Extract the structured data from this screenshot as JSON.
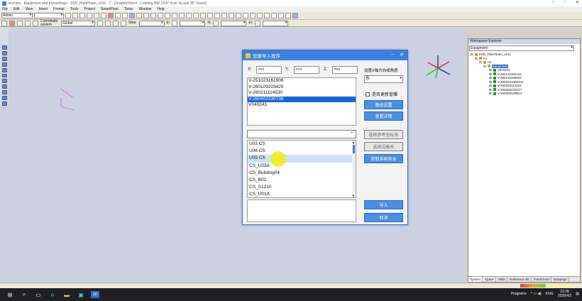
{
  "window": {
    "title": "test.ses - Equipment and Furnishings - SSD_PlantTeam_v131 - T - [GraphicView1 - Looking NW (315° from N) and 35° Down]"
  },
  "menu": [
    "File",
    "Edit",
    "View",
    "Insert",
    "Format",
    "Tools",
    "Project",
    "SmartPlant",
    "Tasks",
    "Window",
    "Help"
  ],
  "toolbar": {
    "filter": "Admin",
    "coord_label": "Coordinate system",
    "coord_value": "Global",
    "step_label": "Step:"
  },
  "dialog": {
    "title": "设备导入程序",
    "x_label": "X:",
    "y_label": "Y:",
    "z_label": "Z:",
    "x_placeholder": "mm",
    "y_placeholder": "mm",
    "z_placeholder": "mm",
    "angle_label": "设置X轴方向或角度",
    "angle_value": "东",
    "vessels": [
      "V-251023161906",
      "V-260109223425",
      "V-260211114530",
      "V-260402230736",
      "V040241"
    ],
    "selected_vessel": "V-260402230736",
    "checkbox_label": "是否更新管嘴",
    "path_button": "路径设置",
    "detail_button": "查看详情",
    "ref_coord_button": "选择参考坐标系",
    "select_equip_button": "选择设备系",
    "get_dir_button": "获取系统目录",
    "cs_items": [
      "U03 CS",
      "U06 CS",
      "U05 CS",
      "CS_U03A",
      "CS_Building04",
      "CS_B02",
      "CS_S1210",
      "CS_U01A"
    ],
    "highlighted_cs": "U05 CS",
    "import_button": "导入",
    "cancel_button": "取消"
  },
  "explorer": {
    "title": "Workspace Explorer",
    "filter": "Equipment",
    "root": "SSD_PlantTeam_v131",
    "a1": "A1",
    "u1": "U1",
    "equipment_node": "Equipment",
    "items": [
      "V040241",
      "V-260112184144",
      "V-260115185003",
      "V-2603241000341",
      "V-260326114224",
      "V-260326120737",
      "V-260326120814"
    ],
    "tabs": [
      "System",
      "Space",
      "WBS",
      "Reference 3D",
      "PointCloud",
      "Drawings"
    ]
  },
  "taskbar": {
    "programs": "Programs",
    "lang": "ENG",
    "time": "23:28",
    "date": "2026/4/2"
  }
}
